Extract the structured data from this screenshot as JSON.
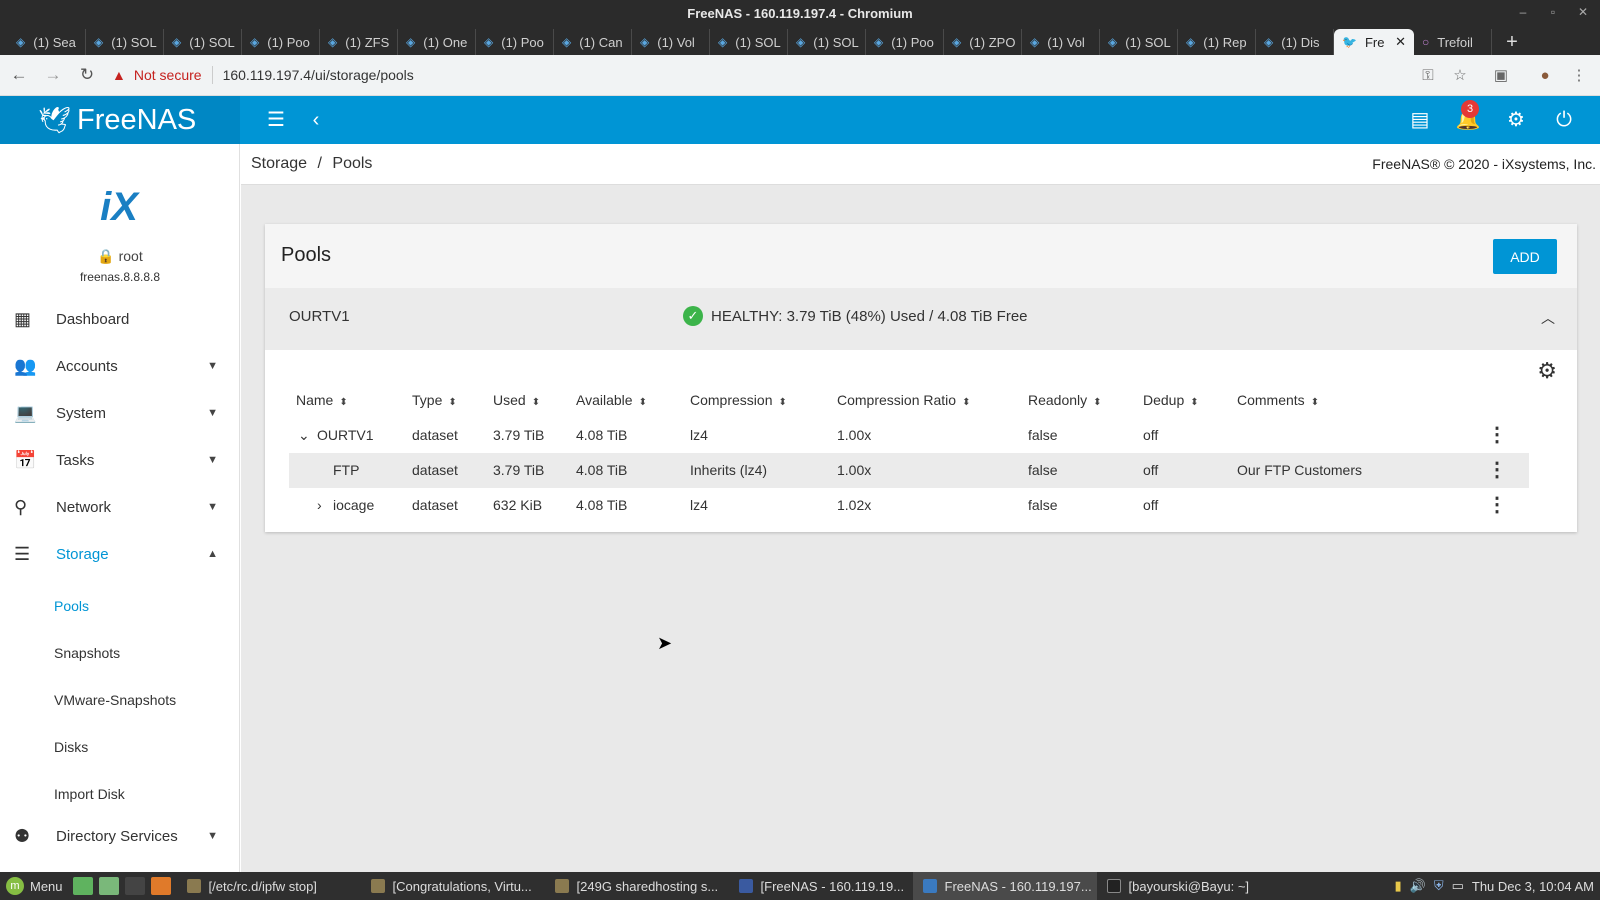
{
  "window": {
    "title": "FreeNAS - 160.119.197.4 - Chromium"
  },
  "tabs": [
    {
      "label": "(1) Sea"
    },
    {
      "label": "(1) SOL"
    },
    {
      "label": "(1) SOL"
    },
    {
      "label": "(1) Poo"
    },
    {
      "label": "(1) ZFS"
    },
    {
      "label": "(1) One"
    },
    {
      "label": "(1) Poo"
    },
    {
      "label": "(1) Can"
    },
    {
      "label": "(1) Vol"
    },
    {
      "label": "(1) SOL"
    },
    {
      "label": "(1) SOL"
    },
    {
      "label": "(1) Poo"
    },
    {
      "label": "(1) ZPO"
    },
    {
      "label": "(1) Vol"
    },
    {
      "label": "(1) SOL"
    },
    {
      "label": "(1) Rep"
    },
    {
      "label": "(1) Dis"
    },
    {
      "label": "Fre"
    },
    {
      "label": "Trefoil"
    }
  ],
  "address": {
    "security": "Not secure",
    "url": "160.119.197.4/ui/storage/pools"
  },
  "header": {
    "brand": "FreeNAS",
    "notification_count": "3"
  },
  "sidebar": {
    "user": "root",
    "hostname": "freenas.8.8.8.8",
    "items": [
      {
        "label": "Dashboard",
        "icon": "dashboard-icon"
      },
      {
        "label": "Accounts",
        "icon": "accounts-icon"
      },
      {
        "label": "System",
        "icon": "laptop-icon"
      },
      {
        "label": "Tasks",
        "icon": "calendar-icon"
      },
      {
        "label": "Network",
        "icon": "network-icon"
      },
      {
        "label": "Storage",
        "icon": "storage-icon"
      }
    ],
    "storage_sub": [
      "Pools",
      "Snapshots",
      "VMware-Snapshots",
      "Disks",
      "Import Disk"
    ],
    "more": {
      "label": "Directory Services",
      "icon": "directory-icon"
    }
  },
  "breadcrumb": {
    "parent": "Storage",
    "separator": "/",
    "current": "Pools"
  },
  "copyright": "FreeNAS® © 2020 - iXsystems, Inc.",
  "pools_card": {
    "title": "Pools",
    "add_label": "ADD",
    "pool_name": "OURTV1",
    "status": "HEALTHY: 3.79 TiB (48%) Used / 4.08 TiB Free"
  },
  "table": {
    "columns": [
      "Name",
      "Type",
      "Used",
      "Available",
      "Compression",
      "Compression Ratio",
      "Readonly",
      "Dedup",
      "Comments"
    ],
    "rows": [
      {
        "name": "OURTV1",
        "type": "dataset",
        "used": "3.79 TiB",
        "available": "4.08 TiB",
        "compression": "lz4",
        "ratio": "1.00x",
        "readonly": "false",
        "dedup": "off",
        "comments": ""
      },
      {
        "name": "FTP",
        "type": "dataset",
        "used": "3.79 TiB",
        "available": "4.08 TiB",
        "compression": "Inherits (lz4)",
        "ratio": "1.00x",
        "readonly": "false",
        "dedup": "off",
        "comments": "Our FTP Customers"
      },
      {
        "name": "iocage",
        "type": "dataset",
        "used": "632 KiB",
        "available": "4.08 TiB",
        "compression": "lz4",
        "ratio": "1.02x",
        "readonly": "false",
        "dedup": "off",
        "comments": ""
      }
    ]
  },
  "taskbar": {
    "menu": "Menu",
    "windows": [
      "[/etc/rc.d/ipfw stop]",
      "[Congratulations, Virtu...",
      "[249G  sharedhosting s...",
      "[FreeNAS - 160.119.19...",
      "FreeNAS - 160.119.197...",
      "[bayourski@Bayu: ~]"
    ],
    "clock": "Thu Dec 3, 10:04 AM"
  }
}
